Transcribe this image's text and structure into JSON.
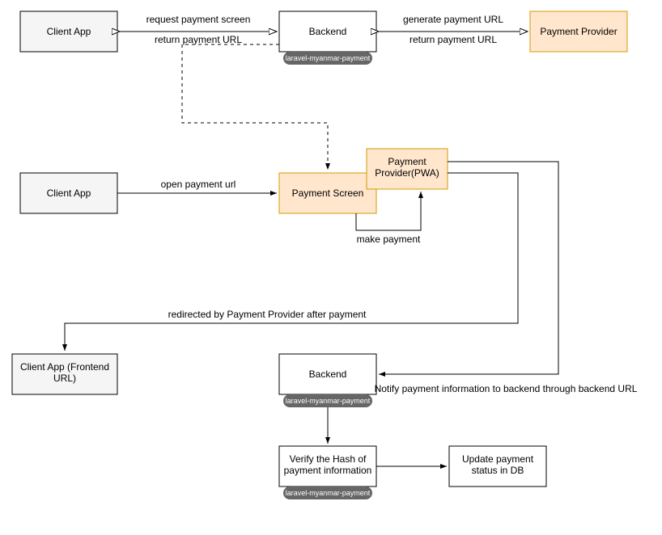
{
  "boxes": {
    "clientApp1": "Client App",
    "backend1": "Backend",
    "pill1": "laravel-myanmar-payment",
    "provider1": "Payment Provider",
    "clientApp2": "Client App",
    "paymentScreen": "Payment Screen",
    "providerPwa": "Payment\nProvider(PWA)",
    "clientApp3": "Client App (Frontend\nURL)",
    "backend2": "Backend",
    "pill2": "laravel-myanmar-payment",
    "verify": "Verify the Hash of\npayment information",
    "pill3": "laravel-myanmar-payment",
    "update": "Update payment\nstatus in DB"
  },
  "labels": {
    "reqScreen": "request payment screen",
    "retUrl1": "return payment URL",
    "genUrl": "generate payment URL",
    "retUrl2": "return payment URL",
    "openUrl": "open payment url",
    "makePay": "make payment",
    "redirected": "redirected by Payment Provider after payment",
    "notify": "Notify payment information to backend through backend URL"
  }
}
